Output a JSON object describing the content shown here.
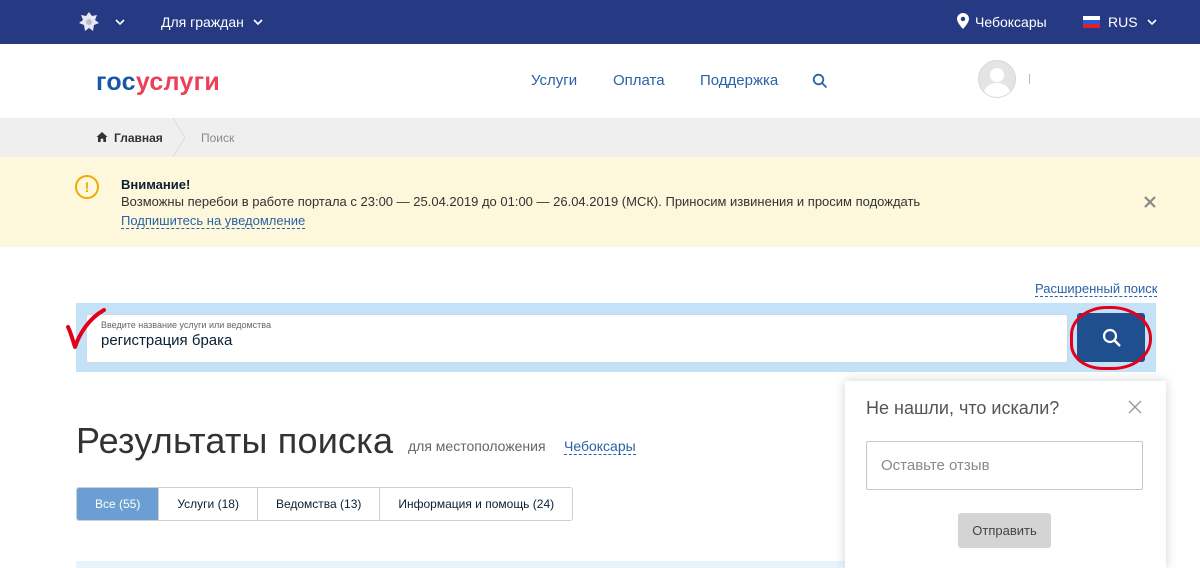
{
  "topbar": {
    "audience_label": "Для граждан",
    "location": "Чебоксары",
    "language": "RUS"
  },
  "header": {
    "logo_part1": "гос",
    "logo_part2": "услуги",
    "nav": [
      "Услуги",
      "Оплата",
      "Поддержка"
    ],
    "user_name": "I"
  },
  "breadcrumb": {
    "home": "Главная",
    "current": "Поиск"
  },
  "alert": {
    "title": "Внимание!",
    "text": "Возможны перебои в работе портала с 23:00 — 25.04.2019 до 01:00 — 26.04.2019 (МСК). Приносим извинения и просим подождать",
    "link": "Подпишитесь на уведомление"
  },
  "search": {
    "advanced_link": "Расширенный поиск",
    "placeholder": "Введите название услуги или ведомства",
    "value": "регистрация брака"
  },
  "results": {
    "title": "Результаты поиска",
    "location_prefix": "для местоположения",
    "location": "Чебоксары",
    "tabs": [
      {
        "label": "Все (55)",
        "active": true
      },
      {
        "label": "Услуги (18)",
        "active": false
      },
      {
        "label": "Ведомства (13)",
        "active": false
      },
      {
        "label": "Информация и помощь (24)",
        "active": false
      }
    ]
  },
  "feedback": {
    "title": "Не нашли, что искали?",
    "placeholder": "Оставьте отзыв",
    "submit": "Отправить"
  },
  "colors": {
    "topbar": "#253a83",
    "logo_blue": "#1a57a4",
    "logo_red": "#ee3f58",
    "link": "#2b62a7",
    "alert_bg": "#fdf7dc",
    "search_panel": "#c4e2f7",
    "search_button": "#1f4f8f",
    "active_tab": "#6b9fd3",
    "annotation_red": "#e3001b"
  },
  "icons": [
    "emblem-icon",
    "chevron-down-icon",
    "location-pin-icon",
    "flag-icon",
    "search-icon",
    "home-icon",
    "warning-icon",
    "close-icon",
    "avatar"
  ]
}
